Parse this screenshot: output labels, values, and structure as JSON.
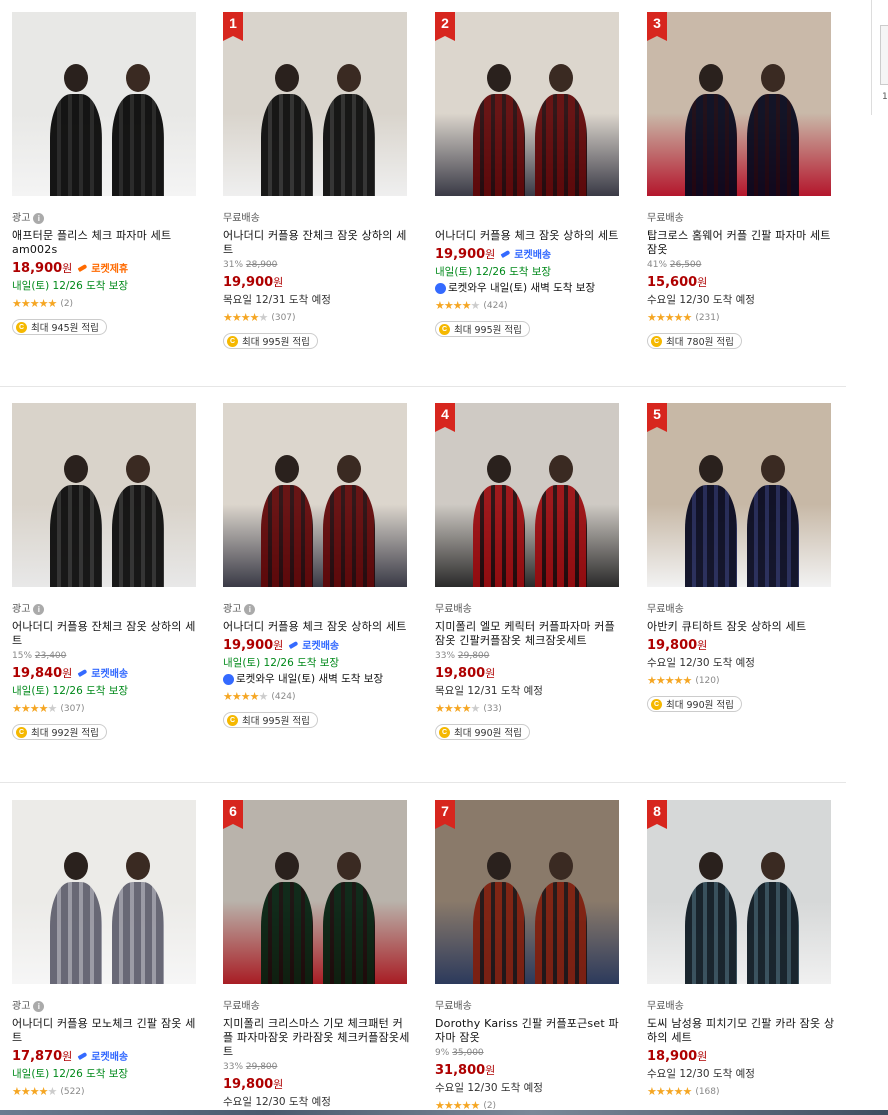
{
  "colors": {
    "price": "#ae0000",
    "rocket": "#346aff",
    "delivery": "#00891a",
    "rank": "#d7261e",
    "star": "#f5a623"
  },
  "side_panel": {
    "number": "1"
  },
  "rows": [
    [
      {
        "rank": "",
        "tag": "광고",
        "ad": true,
        "title": "애프터문 플리스 체크 파자마 세트 am002s",
        "discount_rate": "",
        "original_price": "",
        "price": "18,900",
        "won": "원",
        "badge": "로켓제휴",
        "badge_style": "orange",
        "delivery": "내일(토) 12/26 도착 보장",
        "delivery_style": "green",
        "dawn": "",
        "stars": 5,
        "rating_count": "(2)",
        "reward": "최대 945원 적립",
        "img": [
          "#e8e8e6",
          "#1c1c1c",
          "#f4f4f4"
        ]
      },
      {
        "rank": "1",
        "tag": "무료배송",
        "ad": false,
        "title": "어나더디 커플용 잔체크 잠옷 상하의 세트",
        "discount_rate": "31%",
        "original_price": "28,900",
        "price": "19,900",
        "won": "원",
        "badge": "",
        "badge_style": "",
        "delivery": "목요일 12/31 도착 예정",
        "delivery_style": "gray",
        "dawn": "",
        "stars": 4,
        "rating_count": "(307)",
        "reward": "최대 995원 적립",
        "img": [
          "#d9d4cc",
          "#2a2a2a",
          "#efefef"
        ]
      },
      {
        "rank": "2",
        "tag": "",
        "ad": false,
        "title": "어나더디 커플용 체크 잠옷 상하의 세트",
        "discount_rate": "",
        "original_price": "",
        "price": "19,900",
        "won": "원",
        "badge": "로켓배송",
        "badge_style": "blue",
        "delivery": "내일(토) 12/26 도착 보장",
        "delivery_style": "green",
        "dawn": "로켓와우 내일(토) 새벽 도착 보장",
        "stars": 4,
        "rating_count": "(424)",
        "reward": "최대 995원 적립",
        "img": [
          "#dcd6cd",
          "#9c2228",
          "#3a3a46"
        ]
      },
      {
        "rank": "3",
        "tag": "무료배송",
        "ad": false,
        "title": "탑크로스 홈웨어 커플 긴팔 파자마 세트 잠옷",
        "discount_rate": "41%",
        "original_price": "26,500",
        "price": "15,600",
        "won": "원",
        "badge": "",
        "badge_style": "",
        "delivery": "수요일 12/30 도착 예정",
        "delivery_style": "gray",
        "dawn": "",
        "stars": 4.5,
        "rating_count": "(231)",
        "reward": "최대 780원 적립",
        "img": [
          "#c9b9a9",
          "#1f2a55",
          "#b4162c"
        ]
      }
    ],
    [
      {
        "rank": "",
        "tag": "광고",
        "ad": true,
        "title": "어나더디 커플용 잔체크 잠옷 상하의 세트",
        "discount_rate": "15%",
        "original_price": "23,400",
        "price": "19,840",
        "won": "원",
        "badge": "로켓배송",
        "badge_style": "blue",
        "delivery": "내일(토) 12/26 도착 보장",
        "delivery_style": "green",
        "dawn": "",
        "stars": 4,
        "rating_count": "(307)",
        "reward": "최대 992원 적립",
        "img": [
          "#d9d3ca",
          "#2b2b2b",
          "#e8e8e8"
        ]
      },
      {
        "rank": "",
        "tag": "광고",
        "ad": true,
        "title": "어나더디 커플용 체크 잠옷 상하의 세트",
        "discount_rate": "",
        "original_price": "",
        "price": "19,900",
        "won": "원",
        "badge": "로켓배송",
        "badge_style": "blue",
        "delivery": "내일(토) 12/26 도착 보장",
        "delivery_style": "green",
        "dawn": "로켓와우 내일(토) 새벽 도착 보장",
        "stars": 4,
        "rating_count": "(424)",
        "reward": "최대 995원 적립",
        "img": [
          "#dcd6cd",
          "#9c2228",
          "#3a3a46"
        ]
      },
      {
        "rank": "4",
        "tag": "무료배송",
        "ad": false,
        "title": "지미폴리 엘모 케릭터 커플파자마 커플잠옷 긴팔커플잠옷 체크잠옷세트",
        "discount_rate": "33%",
        "original_price": "29,800",
        "price": "19,800",
        "won": "원",
        "badge": "",
        "badge_style": "",
        "delivery": "목요일 12/31 도착 예정",
        "delivery_style": "gray",
        "dawn": "",
        "stars": 4,
        "rating_count": "(33)",
        "reward": "최대 990원 적립",
        "img": [
          "#cfcac4",
          "#c6323c",
          "#2a2a2a"
        ]
      },
      {
        "rank": "5",
        "tag": "무료배송",
        "ad": false,
        "title": "아반키 큐티하트 잠옷 상하의 세트",
        "discount_rate": "",
        "original_price": "",
        "price": "19,800",
        "won": "원",
        "badge": "",
        "badge_style": "",
        "delivery": "수요일 12/30 도착 예정",
        "delivery_style": "gray",
        "dawn": "",
        "stars": 4.5,
        "rating_count": "(120)",
        "reward": "최대 990원 적립",
        "img": [
          "#c7b8a6",
          "#1d2456",
          "#f2f2f2"
        ]
      }
    ],
    [
      {
        "rank": "",
        "tag": "광고",
        "ad": true,
        "title": "어나더디 커플용 모노체크 긴팔 잠옷 세트",
        "discount_rate": "",
        "original_price": "",
        "price": "17,870",
        "won": "원",
        "badge": "로켓배송",
        "badge_style": "blue",
        "delivery": "내일(토) 12/26 도착 보장",
        "delivery_style": "green",
        "dawn": "",
        "stars": 4,
        "rating_count": "(522)",
        "reward": "",
        "img": [
          "#ecebe8",
          "#9a9aa6",
          "#f6f6f6"
        ]
      },
      {
        "rank": "6",
        "tag": "무료배송",
        "ad": false,
        "title": "지미폴리 크리스마스 기모 체크패턴 커플 파자마잠옷 카라잠옷 체크커플잠옷세트",
        "discount_rate": "33%",
        "original_price": "29,800",
        "price": "19,800",
        "won": "원",
        "badge": "",
        "badge_style": "",
        "delivery": "수요일 12/30 도착 예정",
        "delivery_style": "gray",
        "dawn": "",
        "stars": 0,
        "rating_count": "",
        "reward": "",
        "img": [
          "#b9b3ab",
          "#1d5a3e",
          "#a81d24"
        ]
      },
      {
        "rank": "7",
        "tag": "무료배송",
        "ad": false,
        "title": "Dorothy Kariss 긴팔 커플포근set 파자마 잠옷",
        "discount_rate": "9%",
        "original_price": "35,000",
        "price": "31,800",
        "won": "원",
        "badge": "",
        "badge_style": "",
        "delivery": "수요일 12/30 도착 예정",
        "delivery_style": "gray",
        "dawn": "",
        "stars": 5,
        "rating_count": "(2)",
        "reward": "",
        "img": [
          "#8a7a6a",
          "#b5573a",
          "#2c3a5c"
        ]
      },
      {
        "rank": "8",
        "tag": "무료배송",
        "ad": false,
        "title": "도씨 남성용 피치기모 긴팔 카라 잠옷 상하의 세트",
        "discount_rate": "",
        "original_price": "",
        "price": "18,900",
        "won": "원",
        "badge": "",
        "badge_style": "",
        "delivery": "수요일 12/30 도착 예정",
        "delivery_style": "gray",
        "dawn": "",
        "stars": 4.5,
        "rating_count": "(168)",
        "reward": "",
        "img": [
          "#d6d8d8",
          "#2f4a58",
          "#f0f0f0"
        ]
      }
    ]
  ]
}
